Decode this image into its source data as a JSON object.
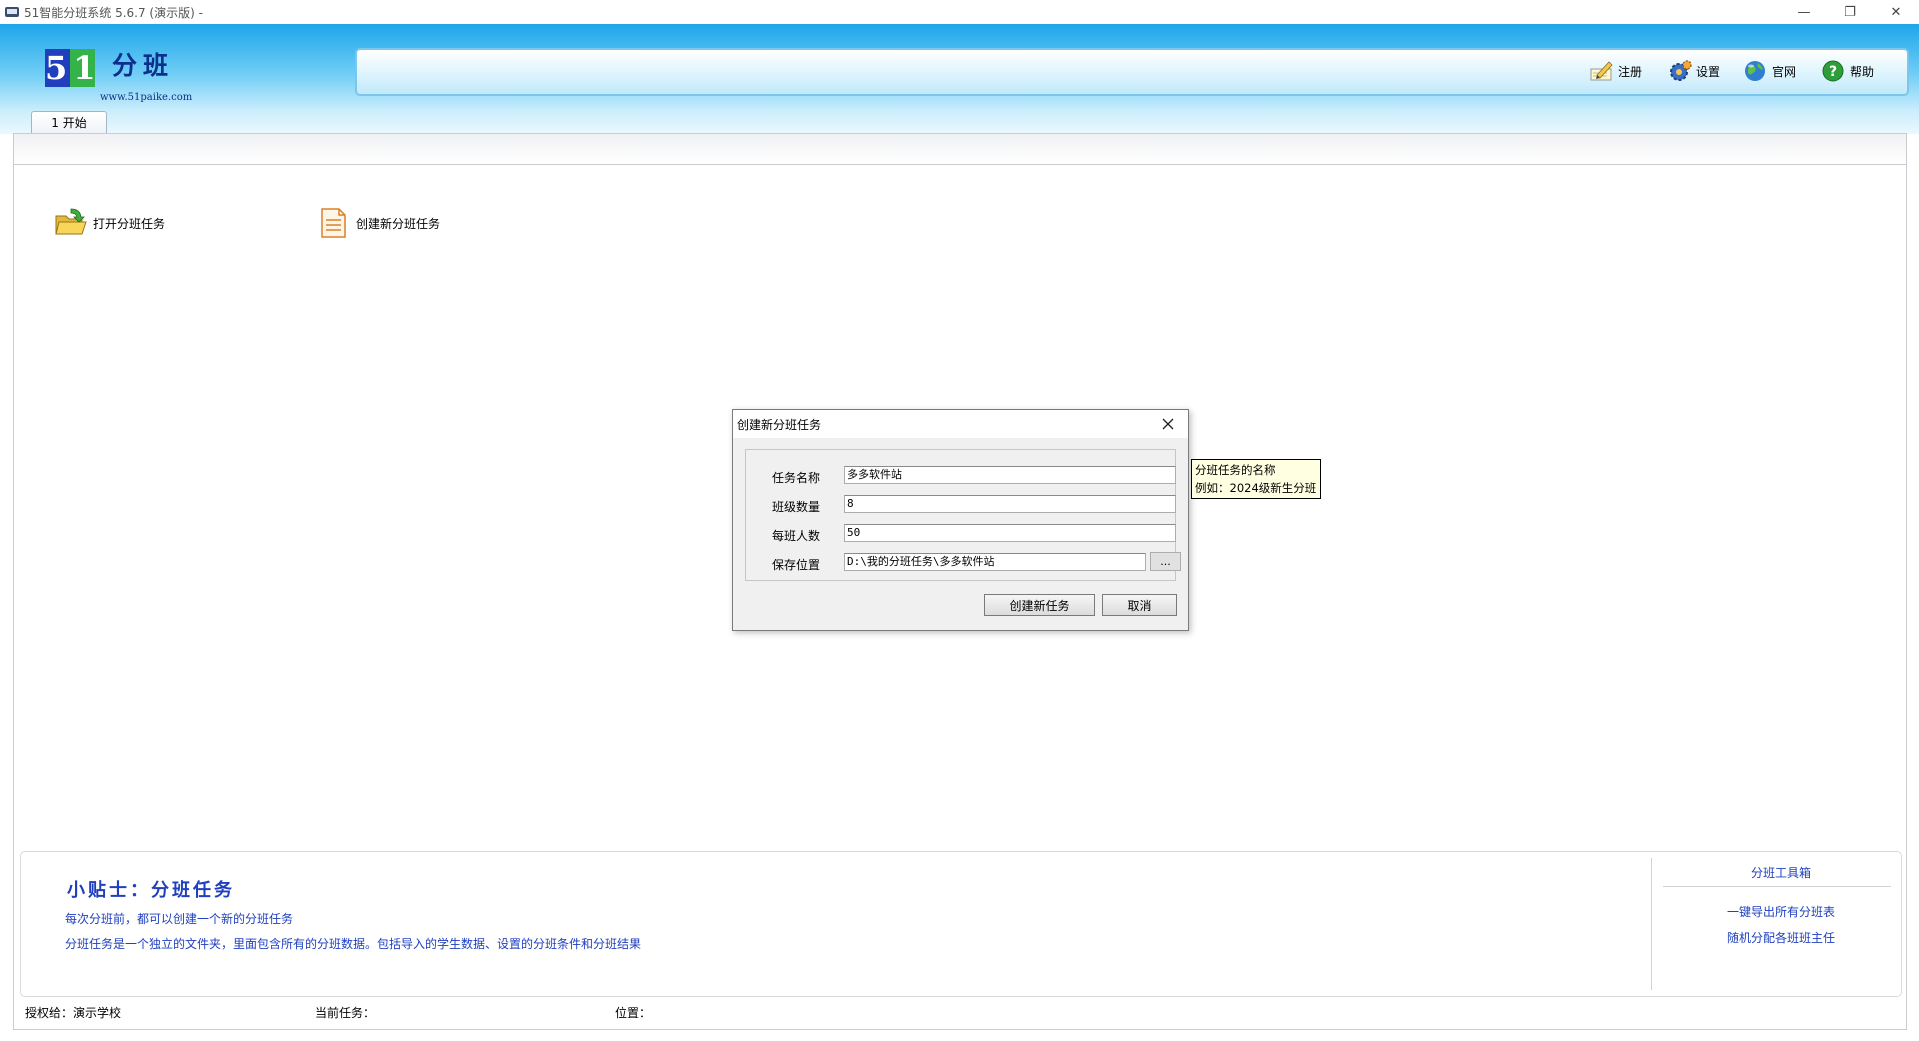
{
  "window": {
    "title": "51智能分班系统 5.6.7 (演示版) -",
    "min_glyph": "—",
    "max_glyph": "❐",
    "close_glyph": "✕"
  },
  "logo": {
    "number": "51",
    "text": "分班",
    "url": "www.51paike.com",
    "colors": {
      "left": "#1f3fbf",
      "right": "#33b34a",
      "text": "#0b2f8a"
    }
  },
  "toolbar": {
    "register_label": "注册",
    "settings_label": "设置",
    "website_label": "官网",
    "help_label": "帮助",
    "register_icon": "pencil-pad-icon",
    "settings_icon": "gear-icon",
    "website_icon": "globe-icon",
    "help_icon": "help-icon"
  },
  "tabs": [
    {
      "label": "1 开始",
      "active": true
    }
  ],
  "actions": {
    "open_task_label": "打开分班任务",
    "new_task_label": "创建新分班任务",
    "open_task_icon": "folder-open-icon",
    "new_task_icon": "document-icon"
  },
  "tips": {
    "title": "小贴士：分班任务",
    "line1": "每次分班前，都可以创建一个新的分班任务",
    "line2": "分班任务是一个独立的文件夹，里面包含所有的分班数据。包括导入的学生数据、设置的分班条件和分班结果"
  },
  "toolbox": {
    "title": "分班工具箱",
    "links": [
      "一键导出所有分班表",
      "随机分配各班班主任"
    ]
  },
  "statusbar": {
    "licensed": "授权给：演示学校",
    "current_task": "当前任务：",
    "location": "位置："
  },
  "dialog": {
    "title": "创建新分班任务",
    "fields": {
      "task_name_label": "任务名称",
      "task_name_value": "多多软件站",
      "class_count_label": "班级数量",
      "class_count_value": "8",
      "per_class_label": "每班人数",
      "per_class_value": "50",
      "save_location_label": "保存位置",
      "save_location_value": "D:\\我的分班任务\\多多软件站"
    },
    "browse_label": "...",
    "create_label": "创建新任务",
    "cancel_label": "取消"
  },
  "tooltip": {
    "line1": "分班任务的名称",
    "line2": "例如：2024级新生分班"
  }
}
